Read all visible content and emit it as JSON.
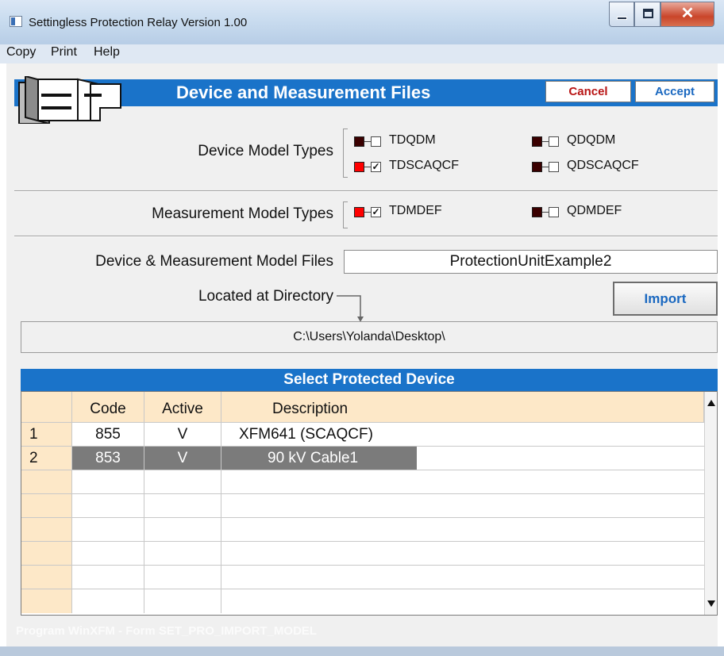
{
  "window": {
    "title": "Settingless Protection Relay Version 1.00"
  },
  "menu": [
    "Copy",
    "Print",
    "Help"
  ],
  "header": {
    "title": "Device and Measurement Files",
    "cancel_label": "Cancel",
    "accept_label": "Accept"
  },
  "device_models": {
    "label": "Device Model Types",
    "options": [
      {
        "name": "TDQDM",
        "checked": false,
        "color": "#3a0000"
      },
      {
        "name": "QDQDM",
        "checked": false,
        "color": "#3a0000"
      },
      {
        "name": "TDSCAQCF",
        "checked": true,
        "color": "#ff0000"
      },
      {
        "name": "QDSCAQCF",
        "checked": false,
        "color": "#3a0000"
      }
    ]
  },
  "measurement_models": {
    "label": "Measurement Model Types",
    "options": [
      {
        "name": "TDMDEF",
        "checked": true,
        "color": "#ff0000"
      },
      {
        "name": "QDMDEF",
        "checked": false,
        "color": "#3a0000"
      }
    ]
  },
  "files": {
    "label": "Device & Measurement Model Files",
    "value": "ProtectionUnitExample2",
    "dir_label": "Located at Directory",
    "import_label": "Import",
    "directory": "C:\\Users\\Yolanda\\Desktop\\"
  },
  "grid": {
    "title": "Select Protected Device",
    "columns": [
      "Code",
      "Active",
      "Description"
    ],
    "rows": [
      {
        "num": "1",
        "code": "855",
        "active": "V",
        "description": "XFM641 (SCAQCF)",
        "selected": false
      },
      {
        "num": "2",
        "code": "853",
        "active": "V",
        "description": "90 kV Cable1",
        "selected": true
      }
    ]
  },
  "status": "Program WinXFM - Form SET_PRO_IMPORT_MODEL",
  "colors": {
    "accent": "#1a73c9",
    "header_band": "#1a73c9",
    "grid_header_bg": "#fde8c8",
    "selected_row": "#7b7b7b"
  }
}
